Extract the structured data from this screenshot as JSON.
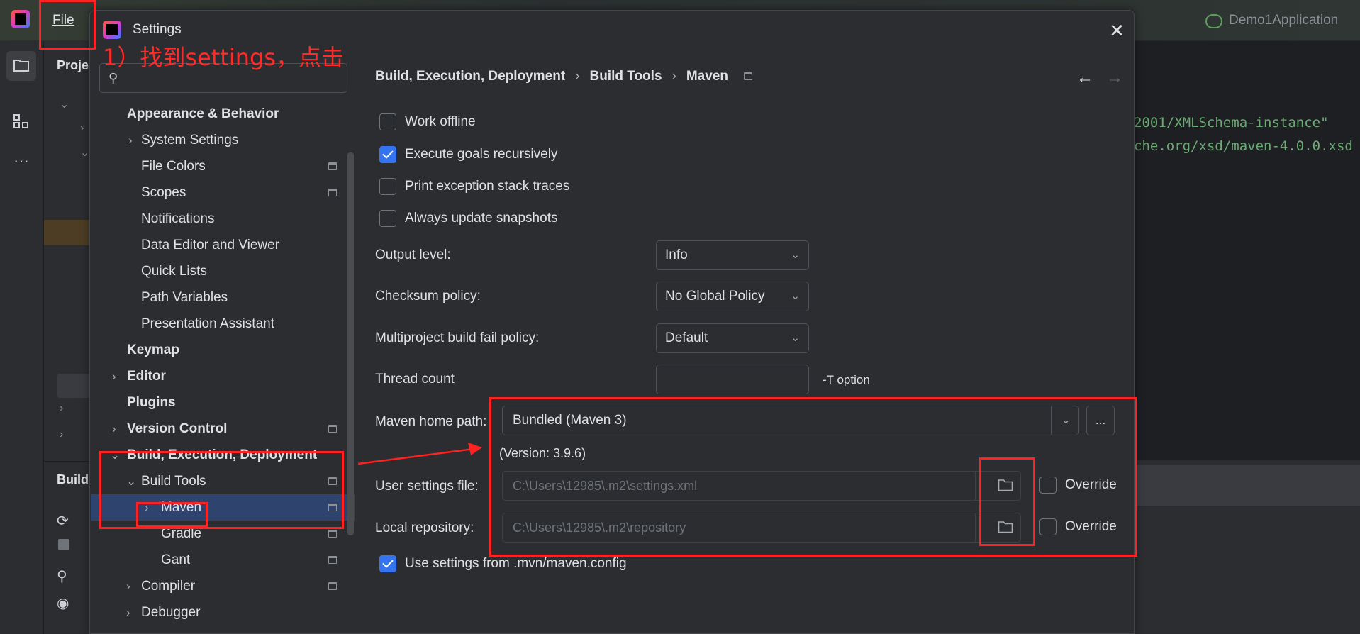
{
  "ide": {
    "menu_file": "File",
    "project_title": "Proje",
    "build_panel_title": "Build",
    "run_config": "Demo1Application",
    "code_lines": [
      "2001/XMLSchema-instance\"",
      "che.org/xsd/maven-4.0.0.xsd"
    ]
  },
  "annotation": {
    "step1": "1）找到settings，点击"
  },
  "dialog": {
    "title": "Settings",
    "search": {
      "placeholder": "",
      "value": ""
    },
    "tree": [
      {
        "label": "Appearance & Behavior",
        "bold": true
      },
      {
        "label": "System Settings"
      },
      {
        "label": "File Colors"
      },
      {
        "label": "Scopes"
      },
      {
        "label": "Notifications"
      },
      {
        "label": "Data Editor and Viewer"
      },
      {
        "label": "Quick Lists"
      },
      {
        "label": "Path Variables"
      },
      {
        "label": "Presentation Assistant"
      },
      {
        "label": "Keymap",
        "bold": true
      },
      {
        "label": "Editor",
        "bold": true
      },
      {
        "label": "Plugins",
        "bold": true
      },
      {
        "label": "Version Control",
        "bold": true
      },
      {
        "label": "Build, Execution, Deployment",
        "bold": true
      },
      {
        "label": "Build Tools"
      },
      {
        "label": "Maven",
        "selected": true
      },
      {
        "label": "Gradle"
      },
      {
        "label": "Gant"
      },
      {
        "label": "Compiler"
      },
      {
        "label": "Debugger"
      }
    ],
    "breadcrumb": [
      "Build, Execution, Deployment",
      "Build Tools",
      "Maven"
    ],
    "options": {
      "work_offline": {
        "label": "Work offline",
        "checked": false
      },
      "execute_goals": {
        "label": "Execute goals recursively",
        "checked": true
      },
      "print_exception": {
        "label": "Print exception stack traces",
        "checked": false
      },
      "always_update": {
        "label": "Always update snapshots",
        "checked": false
      }
    },
    "output_level": {
      "label": "Output level:",
      "value": "Info"
    },
    "checksum_policy": {
      "label": "Checksum policy:",
      "value": "No Global Policy"
    },
    "fail_policy": {
      "label": "Multiproject build fail policy:",
      "value": "Default"
    },
    "thread_count": {
      "label": "Thread count",
      "value": "",
      "hint": "-T option"
    },
    "maven_home": {
      "label": "Maven home path:",
      "value": "Bundled (Maven 3)",
      "browse": "...",
      "version": "(Version: 3.9.6)"
    },
    "user_settings": {
      "label": "User settings file:",
      "value": "C:\\Users\\12985\\.m2\\settings.xml",
      "override": "Override"
    },
    "local_repo": {
      "label": "Local repository:",
      "value": "C:\\Users\\12985\\.m2\\repository",
      "override": "Override"
    },
    "use_mvn_config": {
      "label": "Use settings from .mvn/maven.config",
      "checked": true
    }
  },
  "colors": {
    "annotation_red": "#ff2222",
    "accent_blue": "#3574f0",
    "selection": "#2e436e"
  }
}
